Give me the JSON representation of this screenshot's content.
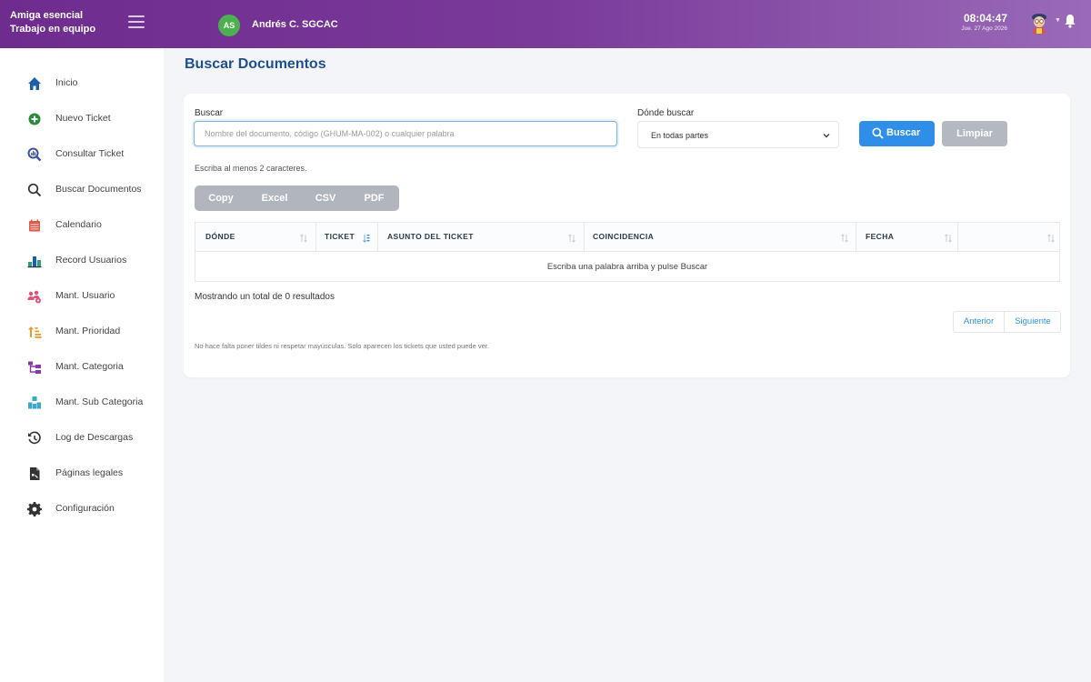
{
  "header": {
    "brand_line1": "Amiga esencial",
    "brand_line2": "Trabajo en equipo",
    "user_initials": "AS",
    "user_name": "Andrés C. SGCAC",
    "time": "08:04:47",
    "date": "Jue. 27 Ago 2026"
  },
  "sidebar": {
    "items": [
      {
        "label": "Inicio",
        "icon": "home-icon",
        "color": "#1f5fa8"
      },
      {
        "label": "Nuevo Ticket",
        "icon": "plus-circle-icon",
        "color": "#2e8b3e"
      },
      {
        "label": "Consultar Ticket",
        "icon": "chart-search-icon",
        "color": "#3a4fa0"
      },
      {
        "label": "Buscar Documentos",
        "icon": "search-icon",
        "color": "#333333"
      },
      {
        "label": "Calendario",
        "icon": "calendar-icon",
        "color": "#e05a4a"
      },
      {
        "label": "Record Usuarios",
        "icon": "bar-chart-icon",
        "color": "#2aa08a"
      },
      {
        "label": "Mant. Usuario",
        "icon": "users-cog-icon",
        "color": "#e0507a"
      },
      {
        "label": "Mant. Prioridad",
        "icon": "sort-priority-icon",
        "color": "#e89a2a"
      },
      {
        "label": "Mant. Categoria",
        "icon": "sitemap-icon",
        "color": "#8a3aa8"
      },
      {
        "label": "Mant. Sub Categoria",
        "icon": "cubes-icon",
        "color": "#3aa8c8"
      },
      {
        "label": "Log de Descargas",
        "icon": "history-icon",
        "color": "#333333"
      },
      {
        "label": "Páginas legales",
        "icon": "document-icon",
        "color": "#333333"
      },
      {
        "label": "Configuración",
        "icon": "gear-icon",
        "color": "#333333"
      }
    ]
  },
  "main": {
    "title": "Buscar Documentos",
    "search_label": "Buscar",
    "search_placeholder": "Nombre del documento, código (GHUM-MA-002) o cualquier palabra",
    "search_value": "",
    "where_label": "Dónde buscar",
    "where_selected": "En todas partes",
    "buscar_button": "Buscar",
    "limpiar_button": "Limpiar",
    "hint": "Escriba al menos 2 caracteres.",
    "export_buttons": [
      "Copy",
      "Excel",
      "CSV",
      "PDF"
    ],
    "table": {
      "columns": [
        "DÓNDE",
        "TICKET",
        "ASUNTO DEL TICKET",
        "COINCIDENCIA",
        "FECHA",
        ""
      ],
      "empty_message": "Escriba una palabra arriba y pulse Buscar"
    },
    "info": "Mostrando un total de 0 resultados",
    "pager": {
      "prev": "Anterior",
      "next": "Siguiente"
    },
    "footnote": "No hace falta poner tildes ni respetar mayúsculas. Solo aparecen los tickets que usted puede ver."
  },
  "colors": {
    "header_gradient_start": "#6e2c8e",
    "header_gradient_end": "#9a6ab8",
    "primary": "#2f8fe8",
    "title": "#1f4f8f",
    "export_bg": "#b1b5bc"
  }
}
